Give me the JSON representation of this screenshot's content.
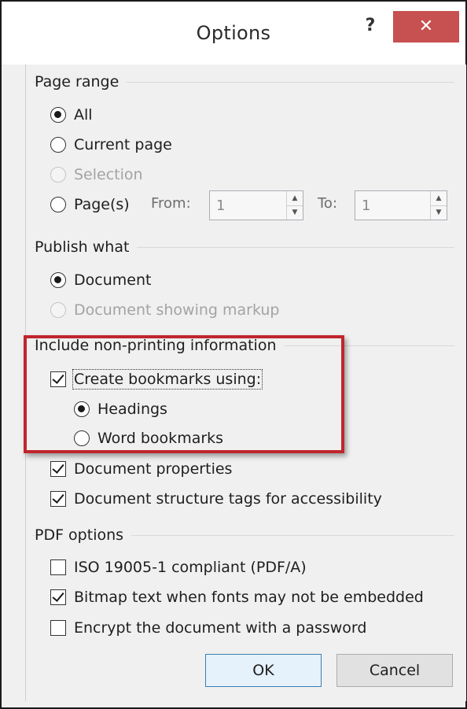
{
  "window": {
    "title": "Options",
    "help_label": "?",
    "close_label": "✕"
  },
  "page_range": {
    "label": "Page range",
    "all_label": "All",
    "current_page_label": "Current page",
    "selection_label": "Selection",
    "pages_label": "Page(s)",
    "from_label": "From:",
    "from_value": "1",
    "to_label": "To:",
    "to_value": "1"
  },
  "publish_what": {
    "label": "Publish what",
    "document_label": "Document",
    "document_markup_label": "Document showing markup"
  },
  "non_printing": {
    "label": "Include non-printing information",
    "create_bookmarks_label": "Create bookmarks using:",
    "headings_label": "Headings",
    "word_bookmarks_label": "Word bookmarks",
    "document_properties_label": "Document properties",
    "structure_tags_label": "Document structure tags for accessibility"
  },
  "pdf_options": {
    "label": "PDF options",
    "iso_label": "ISO 19005-1 compliant (PDF/A)",
    "bitmap_label": "Bitmap text when fonts may not be embedded",
    "encrypt_label": "Encrypt the document with a password"
  },
  "buttons": {
    "ok_label": "OK",
    "cancel_label": "Cancel"
  },
  "colors": {
    "highlight": "#c0262d",
    "close_button": "#c75050",
    "default_button_border": "#3c7fb1"
  }
}
